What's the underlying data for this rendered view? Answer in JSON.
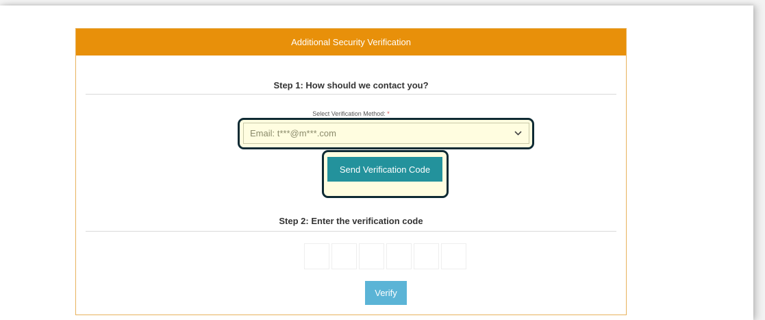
{
  "card": {
    "header_title": "Additional Security Verification"
  },
  "step1": {
    "title": "Step 1: How should we contact you?",
    "method_label": "Select Verification Method:",
    "required_mark": "*",
    "selected_method": "Email: t***@m***.com",
    "send_button": "Send Verification Code"
  },
  "step2": {
    "title": "Step 2: Enter the verification code",
    "code_digit_count": 6,
    "verify_button": "Verify"
  },
  "colors": {
    "header": "#e8900a",
    "send_button": "#23929c",
    "verify_button": "#5bb4d6",
    "highlight": "#fffde0",
    "highlight_border": "#0e2a33"
  },
  "icons": {
    "select_chevron": "chevron-down-icon"
  }
}
